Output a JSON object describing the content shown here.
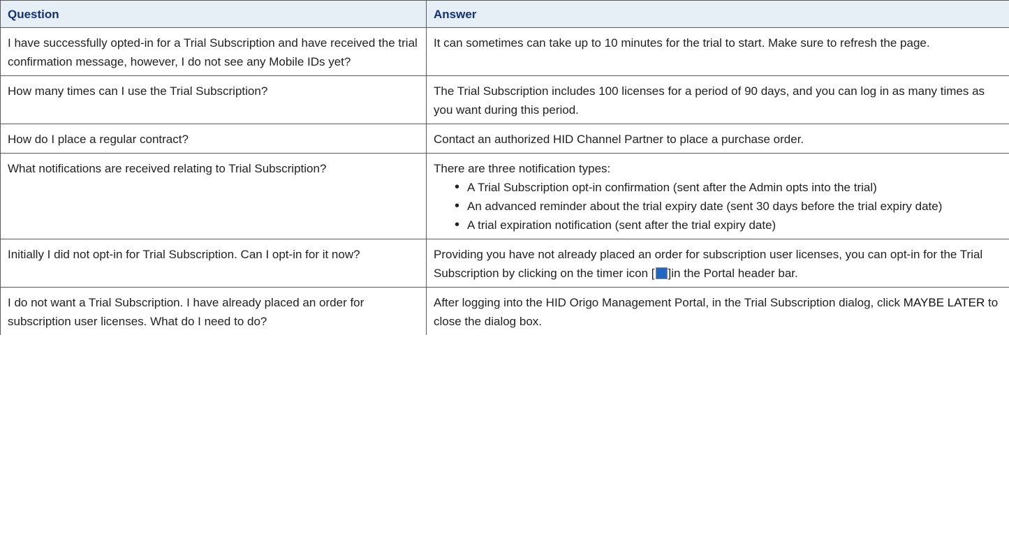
{
  "table": {
    "headers": {
      "question": "Question",
      "answer": "Answer"
    },
    "rows": [
      {
        "question": "I have successfully opted-in for a Trial Subscription and have received the trial confirmation message, however, I do not see any Mobile IDs yet?",
        "answer": "It can sometimes can take up to 10 minutes for the trial to start. Make sure to refresh the page."
      },
      {
        "question": "How many times can I use the Trial Subscription?",
        "answer": "The Trial Subscription includes 100 licenses for a period of 90 days, and you can log in as many times as you want during this period."
      },
      {
        "question": "How do I place a regular contract?",
        "answer": "Contact an authorized HID Channel Partner to place a purchase order."
      },
      {
        "question": "What notifications are received relating to Trial Subscription?",
        "answer_intro": "There are three notification types:",
        "answer_bullets": [
          "A Trial Subscription opt-in confirmation (sent after the Admin opts into the trial)",
          "An advanced reminder about the trial expiry date (sent 30 days before the trial expiry date)",
          "A trial expiration notification (sent after the trial expiry date)"
        ]
      },
      {
        "question": "Initially I did not opt-in for Trial Subscription. Can I opt-in for it now?",
        "answer_before_icon": "Providing you have not already placed an order for subscription user licenses, you can opt-in for the Trial Subscription by clicking on the timer icon [",
        "answer_icon": "timer-icon",
        "answer_after_icon": "]in the Portal header bar."
      },
      {
        "question": "I do not want a Trial Subscription. I have already placed an order for subscription user licenses. What do I need to do?",
        "answer_before_term": "After logging into the HID Origo Management Portal, in the Trial Subscription dialog, click ",
        "answer_term": "MAYBE LATER",
        "answer_after_term": " to close the dialog box."
      }
    ]
  }
}
